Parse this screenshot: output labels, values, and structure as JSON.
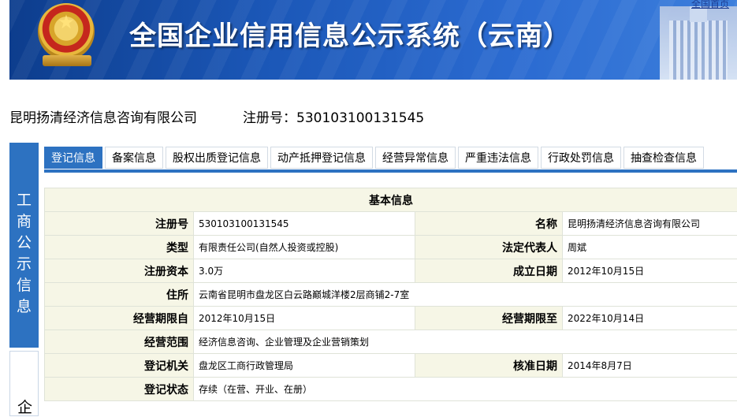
{
  "header": {
    "title": "全国企业信用信息公示系统（云南）",
    "top_link": "全国首页"
  },
  "company": {
    "name": "昆明扬清经济信息咨询有限公司",
    "reg_label": "注册号：",
    "reg_no": "530103100131545"
  },
  "sidebar": {
    "panel1": [
      "工",
      "商",
      "公",
      "示",
      "信",
      "息"
    ],
    "panel2": "企"
  },
  "tabs": [
    "登记信息",
    "备案信息",
    "股权出质登记信息",
    "动产抵押登记信息",
    "经营异常信息",
    "严重违法信息",
    "行政处罚信息",
    "抽查检查信息"
  ],
  "basic_info": {
    "title": "基本信息",
    "rows": [
      {
        "l1": "注册号",
        "v1": "530103100131545",
        "l2": "名称",
        "v2": "昆明扬清经济信息咨询有限公司"
      },
      {
        "l1": "类型",
        "v1": "有限责任公司(自然人投资或控股)",
        "l2": "法定代表人",
        "v2": "周斌"
      },
      {
        "l1": "注册资本",
        "v1": "3.0万",
        "l2": "成立日期",
        "v2": "2012年10月15日"
      },
      {
        "l1": "住所",
        "v1": "云南省昆明市盘龙区白云路巅城洋楼2层商铺2-7室"
      },
      {
        "l1": "经营期限自",
        "v1": "2012年10月15日",
        "l2": "经营期限至",
        "v2": "2022年10月14日"
      },
      {
        "l1": "经营范围",
        "v1": "经济信息咨询、企业管理及企业营销策划"
      },
      {
        "l1": "登记机关",
        "v1": "盘龙区工商行政管理局",
        "l2": "核准日期",
        "v2": "2014年8月7日"
      },
      {
        "l1": "登记状态",
        "v1": "存续（在营、开业、在册）"
      }
    ]
  }
}
